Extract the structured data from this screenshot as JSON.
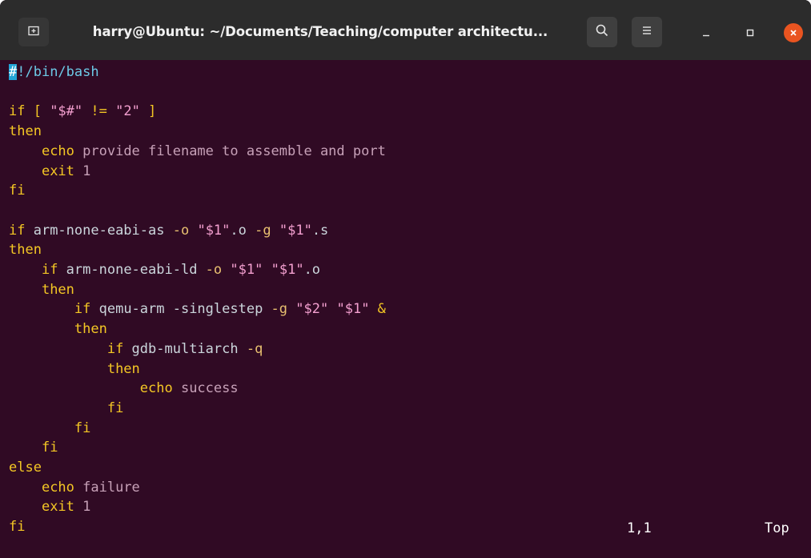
{
  "window": {
    "title": "harry@Ubuntu: ~/Documents/Teaching/computer architectu...",
    "buttons": {
      "new_tab_icon": "new-tab-icon",
      "search_icon": "search-icon",
      "menu_icon": "hamburger-menu-icon",
      "minimize_icon": "minimize-icon",
      "maximize_icon": "maximize-icon",
      "close_icon": "close-icon"
    }
  },
  "editor": {
    "lines": [
      [
        {
          "t": "#",
          "c": "cursor-hash"
        },
        {
          "t": "!/bin/bash",
          "c": "shebang-rest"
        }
      ],
      [],
      [
        {
          "t": "if [ ",
          "c": "kw"
        },
        {
          "t": "\"$#\"",
          "c": "str"
        },
        {
          "t": " != ",
          "c": "kw"
        },
        {
          "t": "\"2\"",
          "c": "str"
        },
        {
          "t": " ]",
          "c": "kw"
        }
      ],
      [
        {
          "t": "then",
          "c": "kw"
        }
      ],
      [
        {
          "t": "    "
        },
        {
          "t": "echo",
          "c": "kw"
        },
        {
          "t": " provide filename to assemble and port",
          "c": "arg"
        }
      ],
      [
        {
          "t": "    "
        },
        {
          "t": "exit",
          "c": "kw"
        },
        {
          "t": " 1",
          "c": "arg"
        }
      ],
      [
        {
          "t": "fi",
          "c": "kw"
        }
      ],
      [],
      [
        {
          "t": "if ",
          "c": "kw"
        },
        {
          "t": "arm-none-eabi-as ",
          "c": "cmd"
        },
        {
          "t": "-o",
          "c": "opt"
        },
        {
          "t": " "
        },
        {
          "t": "\"$1\"",
          "c": "str"
        },
        {
          "t": ".o ",
          "c": "cmd"
        },
        {
          "t": "-g",
          "c": "opt"
        },
        {
          "t": " "
        },
        {
          "t": "\"$1\"",
          "c": "str"
        },
        {
          "t": ".s",
          "c": "cmd"
        }
      ],
      [
        {
          "t": "then",
          "c": "kw"
        }
      ],
      [
        {
          "t": "    "
        },
        {
          "t": "if ",
          "c": "kw"
        },
        {
          "t": "arm-none-eabi-ld ",
          "c": "cmd"
        },
        {
          "t": "-o",
          "c": "opt"
        },
        {
          "t": " "
        },
        {
          "t": "\"$1\"",
          "c": "str"
        },
        {
          "t": " "
        },
        {
          "t": "\"$1\"",
          "c": "str"
        },
        {
          "t": ".o",
          "c": "cmd"
        }
      ],
      [
        {
          "t": "    "
        },
        {
          "t": "then",
          "c": "kw"
        }
      ],
      [
        {
          "t": "        "
        },
        {
          "t": "if ",
          "c": "kw"
        },
        {
          "t": "qemu-arm -singlestep ",
          "c": "cmd"
        },
        {
          "t": "-g",
          "c": "opt"
        },
        {
          "t": " "
        },
        {
          "t": "\"$2\"",
          "c": "str"
        },
        {
          "t": " "
        },
        {
          "t": "\"$1\"",
          "c": "str"
        },
        {
          "t": " &",
          "c": "kw"
        }
      ],
      [
        {
          "t": "        "
        },
        {
          "t": "then",
          "c": "kw"
        }
      ],
      [
        {
          "t": "            "
        },
        {
          "t": "if ",
          "c": "kw"
        },
        {
          "t": "gdb-multiarch ",
          "c": "cmd"
        },
        {
          "t": "-q",
          "c": "opt"
        }
      ],
      [
        {
          "t": "            "
        },
        {
          "t": "then",
          "c": "kw"
        }
      ],
      [
        {
          "t": "                "
        },
        {
          "t": "echo",
          "c": "kw"
        },
        {
          "t": " success",
          "c": "arg"
        }
      ],
      [
        {
          "t": "            "
        },
        {
          "t": "fi",
          "c": "kw"
        }
      ],
      [
        {
          "t": "        "
        },
        {
          "t": "fi",
          "c": "kw"
        }
      ],
      [
        {
          "t": "    "
        },
        {
          "t": "fi",
          "c": "kw"
        }
      ],
      [
        {
          "t": "else",
          "c": "kw"
        }
      ],
      [
        {
          "t": "    "
        },
        {
          "t": "echo",
          "c": "kw"
        },
        {
          "t": " failure",
          "c": "arg"
        }
      ],
      [
        {
          "t": "    "
        },
        {
          "t": "exit",
          "c": "kw"
        },
        {
          "t": " 1",
          "c": "arg"
        }
      ],
      [
        {
          "t": "fi",
          "c": "kw"
        }
      ]
    ],
    "status": {
      "position": "1,1",
      "scroll": "Top"
    }
  }
}
